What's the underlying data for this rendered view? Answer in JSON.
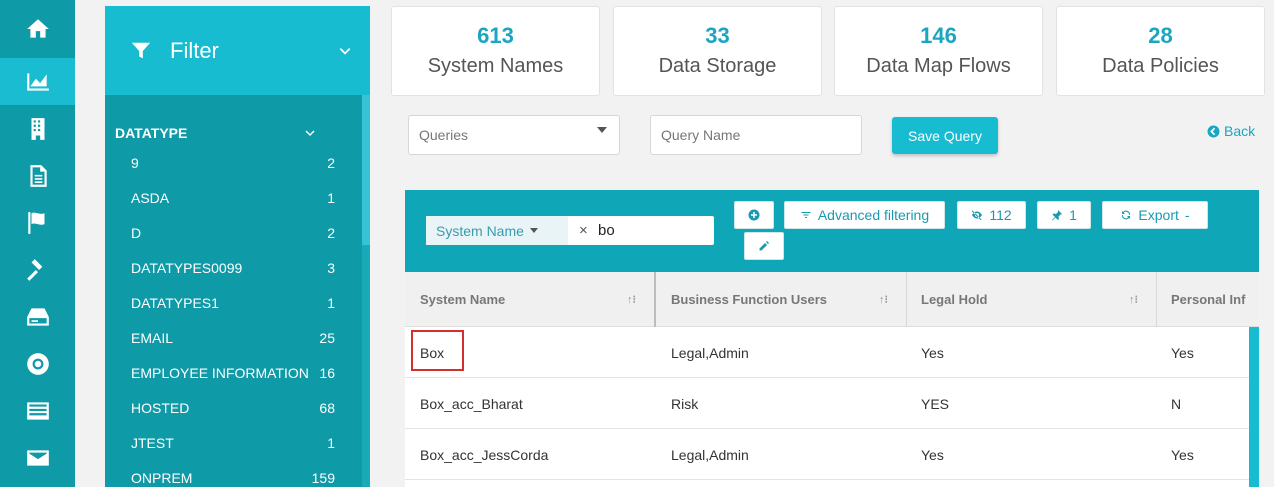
{
  "nav": {
    "items": [
      "home-icon",
      "chart-icon",
      "building-icon",
      "document-icon",
      "flag-icon",
      "gavel-icon",
      "drive-icon",
      "lifebuoy-icon",
      "list-icon",
      "mail-icon"
    ],
    "active_index": 1
  },
  "filter": {
    "title": "Filter",
    "section_title": "DATATYPE",
    "items": [
      {
        "label": "9",
        "count": "2"
      },
      {
        "label": "ASDA",
        "count": "1"
      },
      {
        "label": "D",
        "count": "2"
      },
      {
        "label": "DATATYPES0099",
        "count": "3"
      },
      {
        "label": "DATATYPES1",
        "count": "1"
      },
      {
        "label": "EMAIL",
        "count": "25"
      },
      {
        "label": "EMPLOYEE INFORMATION",
        "count": "16"
      },
      {
        "label": "HOSTED",
        "count": "68"
      },
      {
        "label": "JTEST",
        "count": "1"
      },
      {
        "label": "ONPREM",
        "count": "159"
      }
    ]
  },
  "stats": [
    {
      "value": "613",
      "label": "System Names"
    },
    {
      "value": "33",
      "label": "Data Storage"
    },
    {
      "value": "146",
      "label": "Data Map Flows"
    },
    {
      "value": "28",
      "label": "Data Policies"
    }
  ],
  "query": {
    "queries_placeholder": "Queries",
    "name_placeholder": "Query Name",
    "save_label": "Save Query",
    "back_label": "Back"
  },
  "toolbar": {
    "search_field": "System Name",
    "search_value": "bo",
    "clear": "×",
    "advanced_label": "Advanced filtering",
    "hidden_count": "112",
    "pinned_count": "1",
    "export_label": "Export",
    "export_suffix": "-"
  },
  "table": {
    "columns": [
      "System Name",
      "Business Function Users",
      "Legal Hold",
      "Personal Inf"
    ],
    "rows": [
      [
        "Box",
        "Legal,Admin",
        "Yes",
        "Yes"
      ],
      [
        "Box_acc_Bharat",
        "Risk",
        "YES",
        "N"
      ],
      [
        "Box_acc_JessCorda",
        "Legal,Admin",
        "Yes",
        "Yes"
      ]
    ]
  },
  "colors": {
    "nav": "#0f9aa8",
    "accent": "#18bcd1",
    "stat_number": "#1aa6c0",
    "highlight": "#d32f2f"
  }
}
